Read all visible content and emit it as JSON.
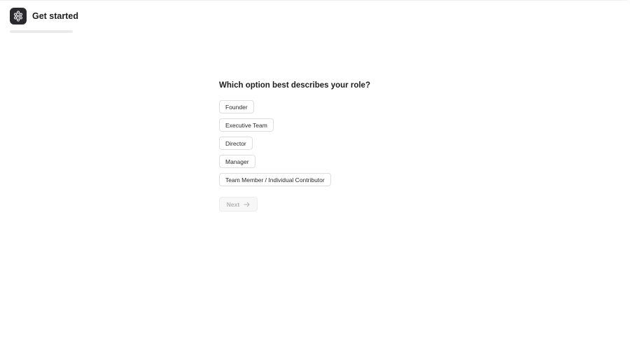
{
  "header": {
    "title": "Get started",
    "logo_icon": "network-nodes-icon"
  },
  "progress": {
    "value_percent": 0
  },
  "question": {
    "text": "Which option best describes your role?",
    "options": [
      "Founder",
      "Executive Team",
      "Director",
      "Manager",
      "Team Member / Individual Contributor"
    ]
  },
  "next_button": {
    "label": "Next",
    "icon": "arrow-right-icon",
    "disabled": true
  },
  "colors": {
    "logo_bg": "#2a2a2e",
    "text": "#1d1d1f",
    "border": "#dedede",
    "disabled_text": "#b5b5b5"
  }
}
